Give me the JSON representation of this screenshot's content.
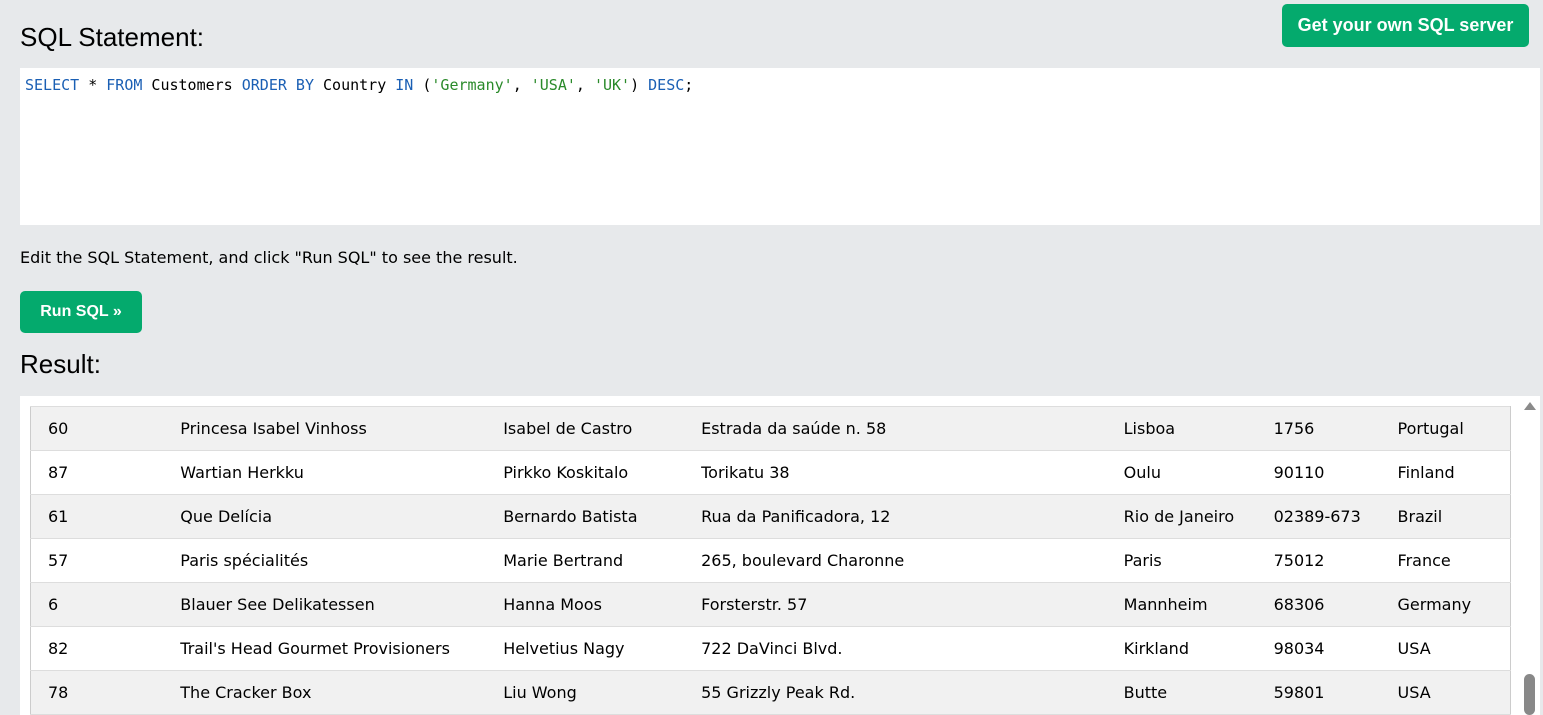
{
  "header": {
    "server_button": "Get your own SQL server",
    "sql_heading": "SQL Statement:",
    "result_heading": "Result:"
  },
  "editor": {
    "tokens": [
      {
        "text": "SELECT",
        "type": "kw"
      },
      {
        "text": " * ",
        "type": "plain"
      },
      {
        "text": "FROM",
        "type": "kw"
      },
      {
        "text": " Customers ",
        "type": "plain"
      },
      {
        "text": "ORDER BY",
        "type": "kw"
      },
      {
        "text": " Country ",
        "type": "plain"
      },
      {
        "text": "IN",
        "type": "kw"
      },
      {
        "text": " (",
        "type": "plain"
      },
      {
        "text": "'Germany'",
        "type": "str"
      },
      {
        "text": ", ",
        "type": "plain"
      },
      {
        "text": "'USA'",
        "type": "str"
      },
      {
        "text": ", ",
        "type": "plain"
      },
      {
        "text": "'UK'",
        "type": "str"
      },
      {
        "text": ") ",
        "type": "plain"
      },
      {
        "text": "DESC",
        "type": "kw"
      },
      {
        "text": ";",
        "type": "plain"
      }
    ]
  },
  "hint": "Edit the SQL Statement, and click \"Run SQL\" to see the result.",
  "run_button": "Run SQL »",
  "colors": {
    "accent": "#04aa6d",
    "keyword": "#1a5fb4",
    "string": "#2a8a2a",
    "background": "#e7e9eb"
  },
  "result": {
    "rows": [
      [
        "60",
        "Princesa Isabel Vinhoss",
        "Isabel de Castro",
        "Estrada da saúde n. 58",
        "Lisboa",
        "1756",
        "Portugal"
      ],
      [
        "87",
        "Wartian Herkku",
        "Pirkko Koskitalo",
        "Torikatu 38",
        "Oulu",
        "90110",
        "Finland"
      ],
      [
        "61",
        "Que Delícia",
        "Bernardo Batista",
        "Rua da Panificadora, 12",
        "Rio de Janeiro",
        "02389-673",
        "Brazil"
      ],
      [
        "57",
        "Paris spécialités",
        "Marie Bertrand",
        "265, boulevard Charonne",
        "Paris",
        "75012",
        "France"
      ],
      [
        "6",
        "Blauer See Delikatessen",
        "Hanna Moos",
        "Forsterstr. 57",
        "Mannheim",
        "68306",
        "Germany"
      ],
      [
        "82",
        "Trail's Head Gourmet Provisioners",
        "Helvetius Nagy",
        "722 DaVinci Blvd.",
        "Kirkland",
        "98034",
        "USA"
      ],
      [
        "78",
        "The Cracker Box",
        "Liu Wong",
        "55 Grizzly Peak Rd.",
        "Butte",
        "59801",
        "USA"
      ]
    ]
  },
  "scrollbar": {
    "up_icon": "triangle-up"
  }
}
